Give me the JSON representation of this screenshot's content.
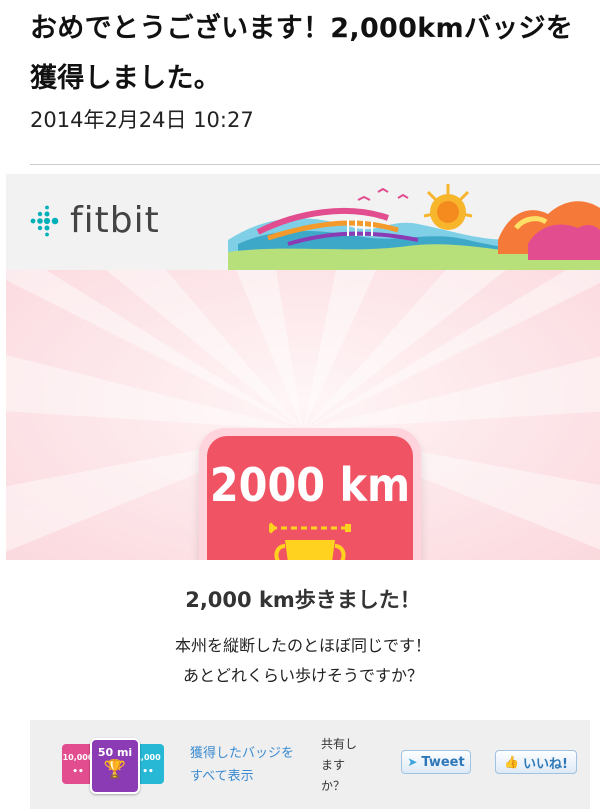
{
  "header": {
    "subject": "おめでとうございます！2,000kmバッジを獲得しました。",
    "date": "2014年2月24日 10:27"
  },
  "email": {
    "brand": "fitbit",
    "badge": {
      "label": "2000 km",
      "icon": "trophy-icon"
    },
    "title": "2,000 km歩きました！",
    "description_line1": "本州を縦断したのとほぼ同じです！",
    "description_line2": "あとどれくらい歩けそうですか？",
    "footer": {
      "mini_badges": [
        "10,000",
        "50 mi",
        "1,000"
      ],
      "view_all_link": "獲得したバッジをすべて表示",
      "share_prompt": "共有しますか？",
      "tweet_button": "Tweet",
      "like_button": "いいね!"
    }
  },
  "colors": {
    "badge_red": "#f05464",
    "trophy_gold": "#ffd21f",
    "link_blue": "#3b8bd0",
    "hero_pink": "#fbd9de"
  }
}
